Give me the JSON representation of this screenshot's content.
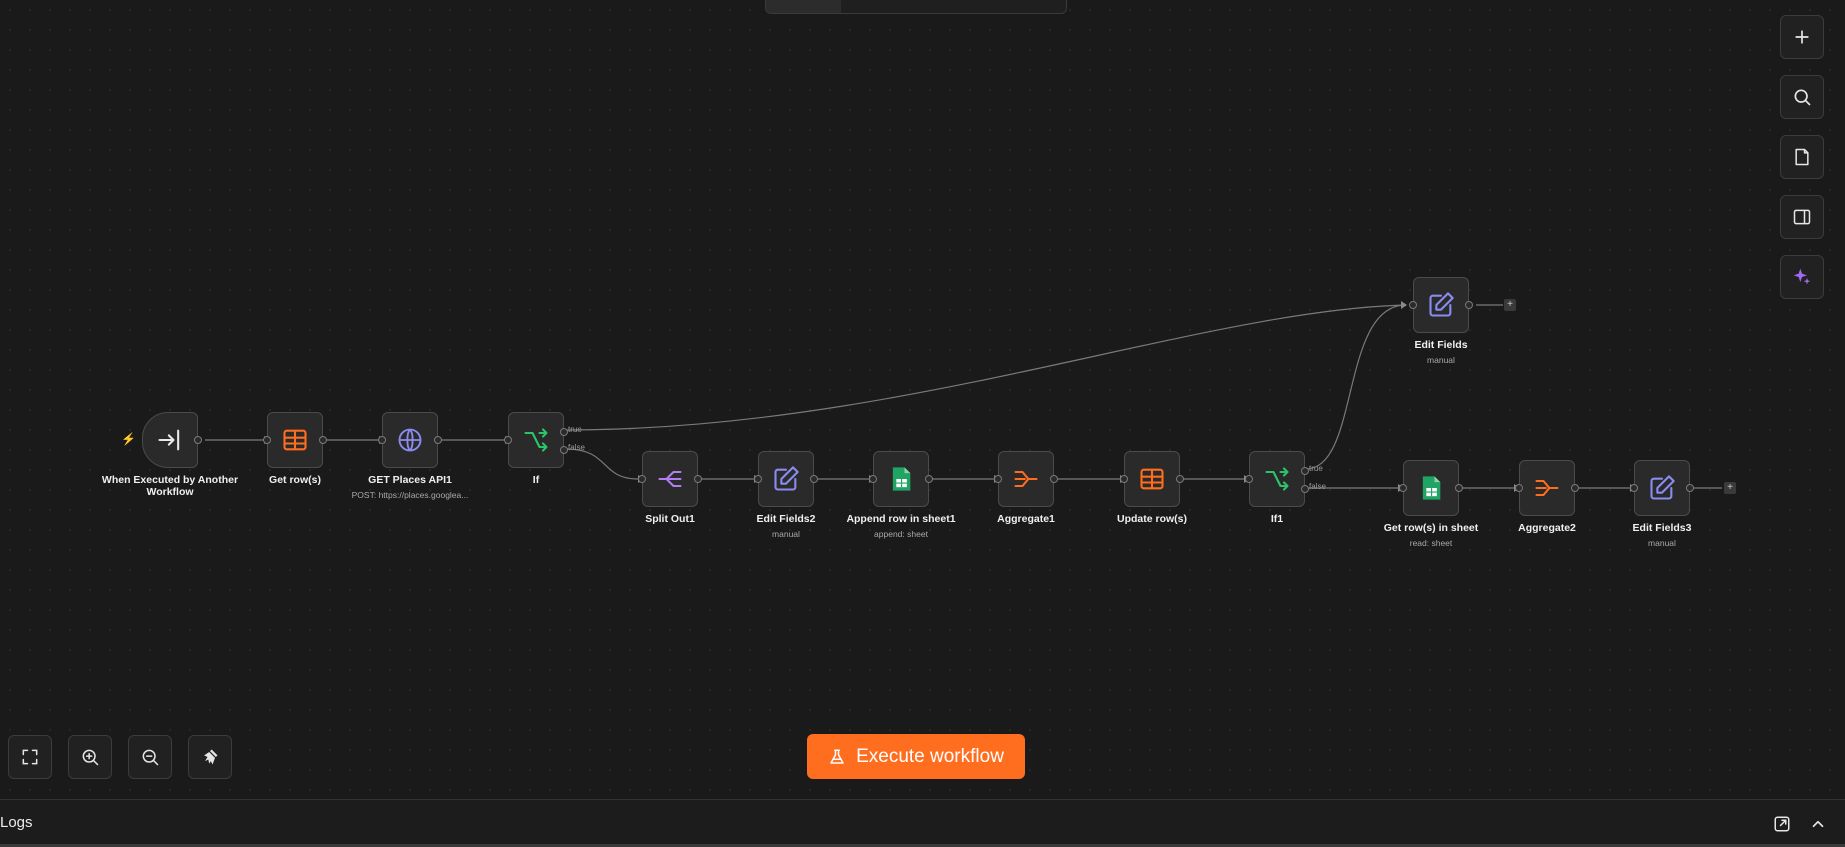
{
  "nodes": {
    "trigger": {
      "label": "When Executed by Another Workflow"
    },
    "get_rows": {
      "label": "Get row(s)"
    },
    "get_places": {
      "label": "GET Places API1",
      "sub": "POST: https://places.googlea..."
    },
    "if": {
      "label": "If",
      "true_label": "true",
      "false_label": "false"
    },
    "split_out": {
      "label": "Split Out1"
    },
    "edit_fields2": {
      "label": "Edit Fields2",
      "sub": "manual"
    },
    "append_row": {
      "label": "Append row in sheet1",
      "sub": "append: sheet"
    },
    "aggregate1": {
      "label": "Aggregate1"
    },
    "update_rows": {
      "label": "Update row(s)"
    },
    "if1": {
      "label": "If1",
      "true_label": "true",
      "false_label": "false"
    },
    "edit_fields": {
      "label": "Edit Fields",
      "sub": "manual"
    },
    "get_rows_sheet": {
      "label": "Get row(s) in sheet",
      "sub": "read: sheet"
    },
    "aggregate2": {
      "label": "Aggregate2"
    },
    "edit_fields3": {
      "label": "Edit Fields3",
      "sub": "manual"
    }
  },
  "icons": {
    "trigger": "enter-icon",
    "get_rows": "table-icon",
    "get_places": "globe-icon",
    "if": "branch-icon",
    "split_out": "split-icon",
    "edit": "pencil-icon",
    "sheet": "google-sheet-icon",
    "aggregate": "merge-icon"
  },
  "plus_glyph": "+",
  "bolt_glyph": "⚡",
  "execute_button": {
    "label": "Execute workflow"
  },
  "logs": {
    "title": "Logs"
  },
  "colors": {
    "accent": "#ff6d1f",
    "canvas": "#1a1a1a",
    "node_bg": "#2a2a2a",
    "edit_icon": "#8a8cf0",
    "if_icon": "#2cc46b",
    "split_icon": "#b07ef0",
    "sheet_icon": "#1fa463",
    "ai_icon": "#a06bf0"
  }
}
